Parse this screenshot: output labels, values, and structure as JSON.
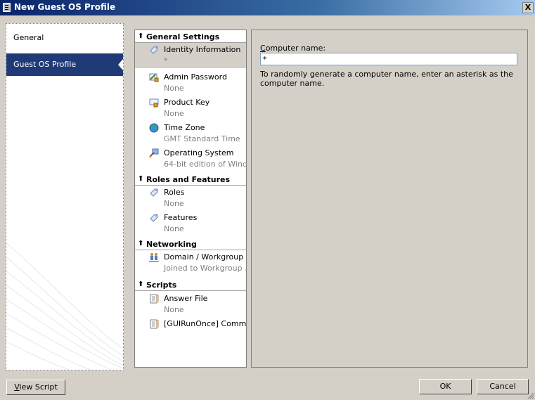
{
  "window": {
    "title": "New Guest OS Profile",
    "close_label": "X"
  },
  "nav": {
    "items": [
      {
        "label": "General"
      },
      {
        "label": "Guest OS Profile"
      }
    ]
  },
  "settings": {
    "general": {
      "title": "General Settings",
      "items": [
        {
          "label": "Identity Information",
          "value": "*"
        },
        {
          "label": "Admin Password",
          "value": "None"
        },
        {
          "label": "Product Key",
          "value": "None"
        },
        {
          "label": "Time Zone",
          "value": "GMT Standard Time"
        },
        {
          "label": "Operating System",
          "value": "64-bit edition of Wind..."
        }
      ]
    },
    "roles": {
      "title": "Roles and Features",
      "items": [
        {
          "label": "Roles",
          "value": "None"
        },
        {
          "label": "Features",
          "value": "None"
        }
      ]
    },
    "networking": {
      "title": "Networking",
      "items": [
        {
          "label": "Domain / Workgroup",
          "value": "Joined to Workgroup ..."
        }
      ]
    },
    "scripts": {
      "title": "Scripts",
      "items": [
        {
          "label": "Answer File",
          "value": "None"
        },
        {
          "label": "[GUIRunOnce] Comm...",
          "value": ""
        }
      ]
    }
  },
  "detail": {
    "label_first": "C",
    "label_rest": "omputer name:",
    "value": "*",
    "help": "To randomly generate a computer name, enter an asterisk as the computer name."
  },
  "buttons": {
    "view_script_first": "V",
    "view_script_rest": "iew Script",
    "ok": "OK",
    "cancel": "Cancel"
  },
  "colors": {
    "nav_selected": "#203a77",
    "title_bar": "#0a246a",
    "dialog_bg": "#d4d0c8"
  }
}
